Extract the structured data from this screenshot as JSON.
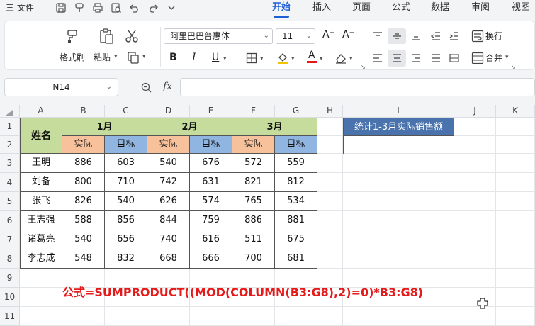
{
  "menu": {
    "file_label": "三 文件",
    "tabs": [
      {
        "label": "开始",
        "active": true
      },
      {
        "label": "插入",
        "active": false
      },
      {
        "label": "页面",
        "active": false
      },
      {
        "label": "公式",
        "active": false
      },
      {
        "label": "数据",
        "active": false
      },
      {
        "label": "审阅",
        "active": false
      },
      {
        "label": "视图",
        "active": false
      }
    ],
    "quick_access_icons": [
      "save-icon",
      "brush-icon",
      "print-icon",
      "preview-icon",
      "undo-icon",
      "redo-icon",
      "chevron-down-icon"
    ]
  },
  "ribbon": {
    "format_painter_label": "格式刷",
    "paste_label": "粘贴",
    "font_name": "阿里巴巴普惠体",
    "font_size": "11",
    "wrap_label": "换行",
    "merge_label": "合并",
    "bold_glyph": "B",
    "italic_glyph": "I",
    "underline_glyph": "U",
    "grow_font_glyph": "A⁺",
    "shrink_font_glyph": "A⁻",
    "font_color_glyph": "A"
  },
  "formula_bar": {
    "name_box": "N14",
    "fx_label": "fx",
    "formula": ""
  },
  "sheet": {
    "columns": [
      "A",
      "B",
      "C",
      "D",
      "E",
      "F",
      "G",
      "H",
      "I",
      "J",
      "K"
    ],
    "rows": [
      "1",
      "2",
      "3",
      "4",
      "5",
      "6",
      "7",
      "8",
      "9",
      "10",
      "11"
    ],
    "header_name": "姓名",
    "months": [
      "1月",
      "2月",
      "3月"
    ],
    "sub_actual": "实际",
    "sub_target": "目标",
    "people": [
      {
        "name": "王明",
        "values": [
          "886",
          "603",
          "540",
          "676",
          "572",
          "559"
        ]
      },
      {
        "name": "刘备",
        "values": [
          "800",
          "710",
          "742",
          "631",
          "821",
          "812"
        ]
      },
      {
        "name": "张飞",
        "values": [
          "826",
          "540",
          "626",
          "574",
          "765",
          "534"
        ]
      },
      {
        "name": "王志强",
        "values": [
          "588",
          "856",
          "844",
          "759",
          "886",
          "881"
        ]
      },
      {
        "name": "诸葛亮",
        "values": [
          "540",
          "656",
          "740",
          "616",
          "511",
          "675"
        ]
      },
      {
        "name": "李志成",
        "values": [
          "548",
          "832",
          "668",
          "666",
          "700",
          "681"
        ]
      }
    ],
    "summary_header": "统计1-3月实际销售额",
    "summary_value": "",
    "formula_note": "公式=SUMPRODUCT((MOD(COLUMN(B3:G8),2)=0)*B3:G8)"
  },
  "colors": {
    "accent": "#1f5fd6",
    "header_green": "#c6dc9d",
    "actual_orange": "#f6c19b",
    "target_blue": "#8fb5e0",
    "summary_navy": "#4a73ad",
    "formula_red": "#e51b1b"
  }
}
